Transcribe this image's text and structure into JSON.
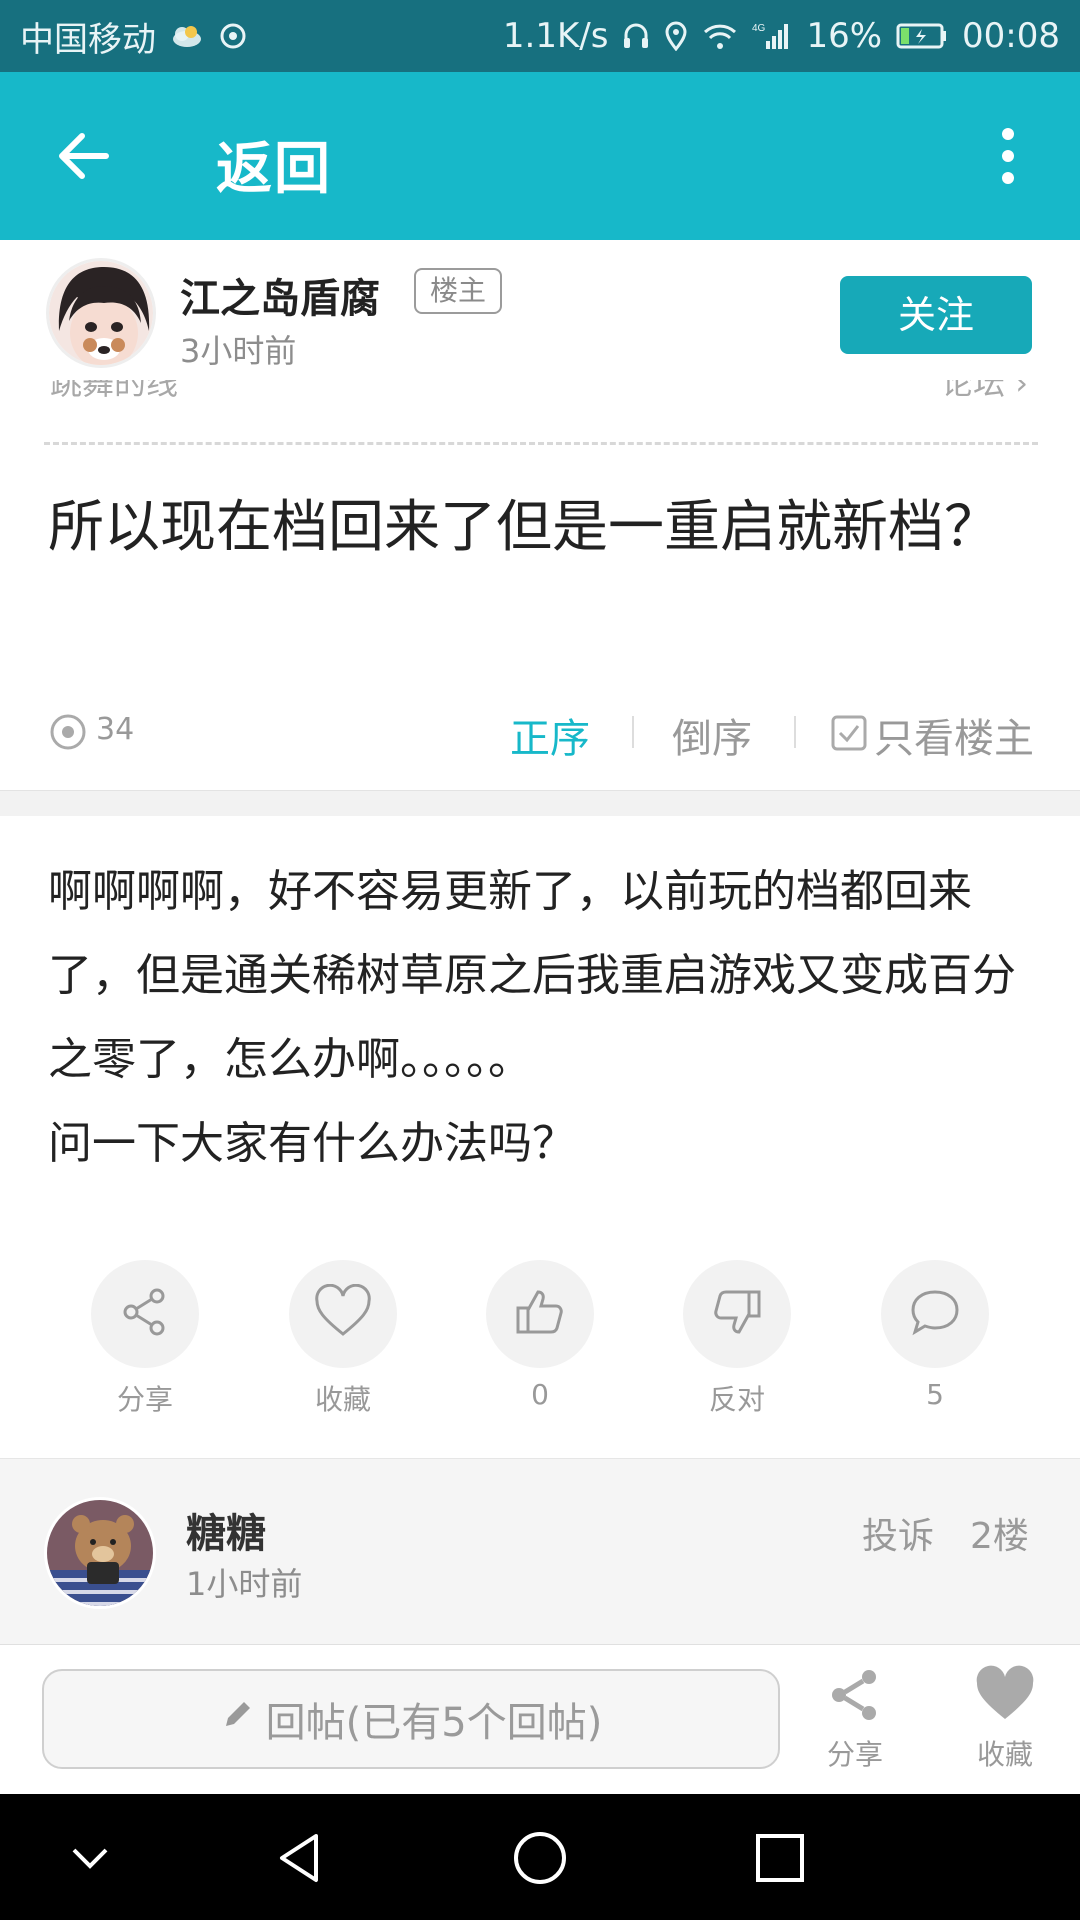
{
  "status_bar": {
    "carrier": "中国移动",
    "speed": "1.1K/s",
    "battery": "16%",
    "time": "00:08",
    "network": "4G"
  },
  "app_bar": {
    "title": "返回"
  },
  "author": {
    "name": "江之岛盾腐",
    "badge": "楼主",
    "time": "3小时前",
    "follow_label": "关注"
  },
  "clipped_strip": {
    "left_text": "跳舞的线",
    "right_text": "论坛 ›"
  },
  "post": {
    "title": "所以现在档回来了但是一重启就新档？",
    "views": "34",
    "order_asc": "正序",
    "order_desc": "倒序",
    "op_only": "只看楼主",
    "body_lines": [
      "啊啊啊啊，好不容易更新了，以前玩的档都回来了，但是通关稀树草原之后我重启游戏又变成百分之零了，怎么办啊。。。。。",
      "问一下大家有什么办法吗？"
    ]
  },
  "actions": [
    {
      "icon": "share-icon",
      "label": "分享"
    },
    {
      "icon": "heart-icon",
      "label": "收藏"
    },
    {
      "icon": "thumbs-up-icon",
      "label": "0"
    },
    {
      "icon": "thumbs-down-icon",
      "label": "反对"
    },
    {
      "icon": "comment-icon",
      "label": "5"
    }
  ],
  "reply": {
    "name": "糖糖",
    "time": "1小时前",
    "report": "投诉",
    "floor": "2楼"
  },
  "bottom_bar": {
    "reply_placeholder": "回帖(已有5个回帖)",
    "share_label": "分享",
    "favorite_label": "收藏"
  },
  "colors": {
    "accent": "#17b8c9",
    "status_bar": "#17707f",
    "follow_button": "#17a9b8"
  }
}
